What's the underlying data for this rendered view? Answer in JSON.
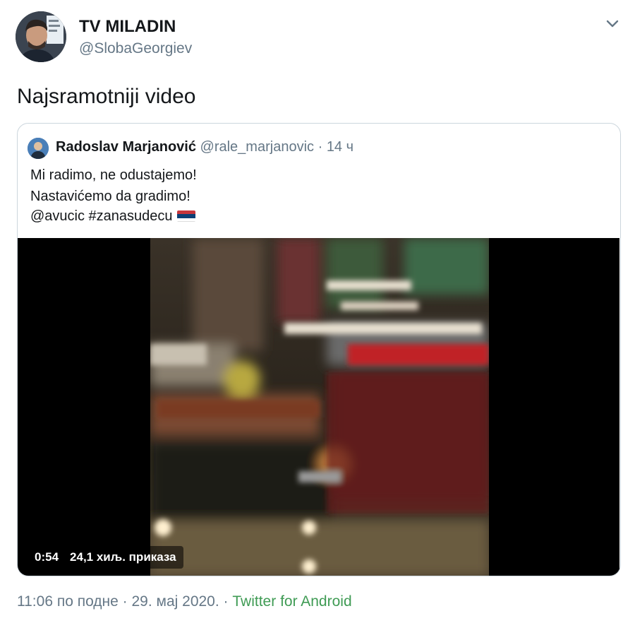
{
  "author": {
    "name": "TV MILADIN",
    "handle": "@SlobaGeorgiev"
  },
  "tweet": {
    "text": "Najsramotniji video"
  },
  "quoted_tweet": {
    "name": "Radoslav Marjanović",
    "handle": "@rale_marjanovic",
    "separator": "·",
    "time": "14 ч",
    "lines": [
      "Mi radimo, ne odustajemo!",
      "Nastavićemo da gradimo!",
      "@avucic #zanasudecu"
    ],
    "flag_icon": "serbia-flag-icon",
    "video": {
      "duration": "0:54",
      "views": "24,1 хиљ. приказа"
    }
  },
  "footer": {
    "timestamp": "11:06 по подне · 29. мај 2020.",
    "separator": "·",
    "source": "Twitter for Android"
  },
  "colors": {
    "text": "#14171a",
    "muted": "#657786",
    "source_link": "#3f9b54",
    "border": "#ccd6dd"
  }
}
